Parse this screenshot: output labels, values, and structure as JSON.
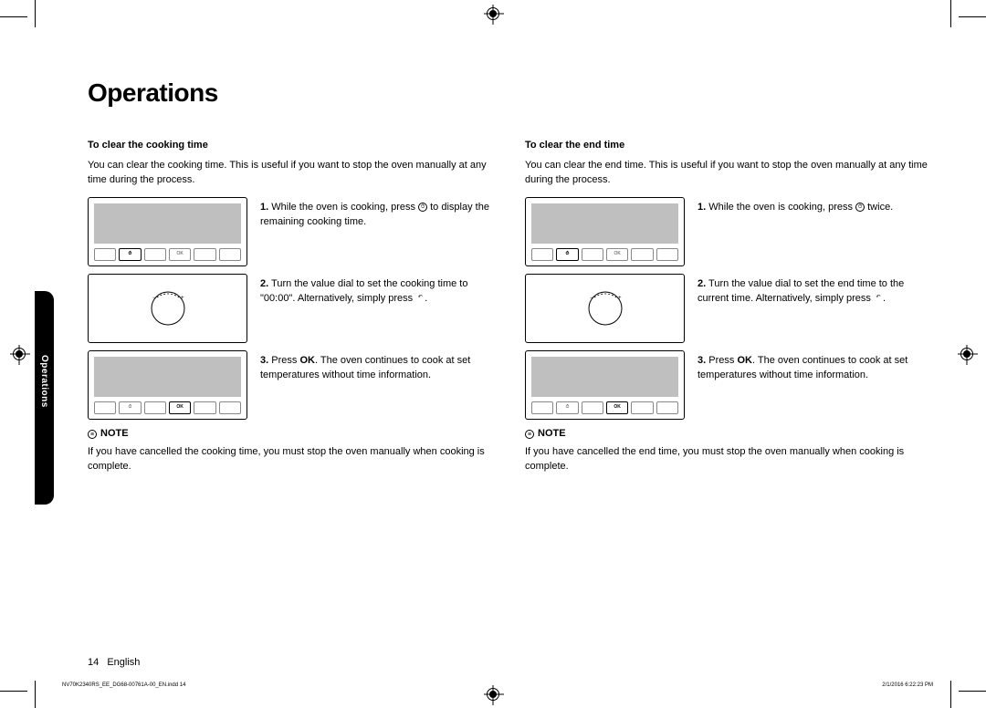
{
  "title": "Operations",
  "side_tab": "Operations",
  "left": {
    "heading": "To clear the cooking time",
    "intro": "You can clear the cooking time. This is useful if you want to stop the oven manually at any time during the process.",
    "step1_pre": "While the oven is cooking, press ",
    "step1_post": " to display the remaining cooking time.",
    "step2_pre": "Turn the value dial to set the cooking time to \"00:00\". Alternatively, simply press ",
    "step2_post": ".",
    "step3_a": "Press ",
    "step3_ok": "OK",
    "step3_b": ". The oven continues to cook at set temperatures without time information.",
    "note_label": "NOTE",
    "note_body": "If you have cancelled the cooking time, you must stop the oven manually when cooking is complete."
  },
  "right": {
    "heading": "To clear the end time",
    "intro": "You can clear the end time. This is useful if you want to stop the oven manually at any time during the process.",
    "step1_pre": "While the oven is cooking, press ",
    "step1_post": " twice.",
    "step2_pre": "Turn the value dial to set the end time to the current time. Alternatively, simply press ",
    "step2_post": ".",
    "step3_a": "Press ",
    "step3_ok": "OK",
    "step3_b": ". The oven continues to cook at set temperatures without time information.",
    "note_label": "NOTE",
    "note_body": "If you have cancelled the end time, you must stop the oven manually when cooking is complete."
  },
  "footer": {
    "page": "14",
    "lang": "English"
  },
  "meta": {
    "file": "NV70K2340RS_EE_DG68-00761A-00_EN.indd   14",
    "date": "2/1/2016   6:22:23 PM"
  },
  "icons": {
    "clock": "clock-icon",
    "back": "back-icon",
    "note": "note-icon"
  },
  "btn_labels": [
    "",
    "⏱",
    "",
    "OK",
    "",
    ""
  ]
}
